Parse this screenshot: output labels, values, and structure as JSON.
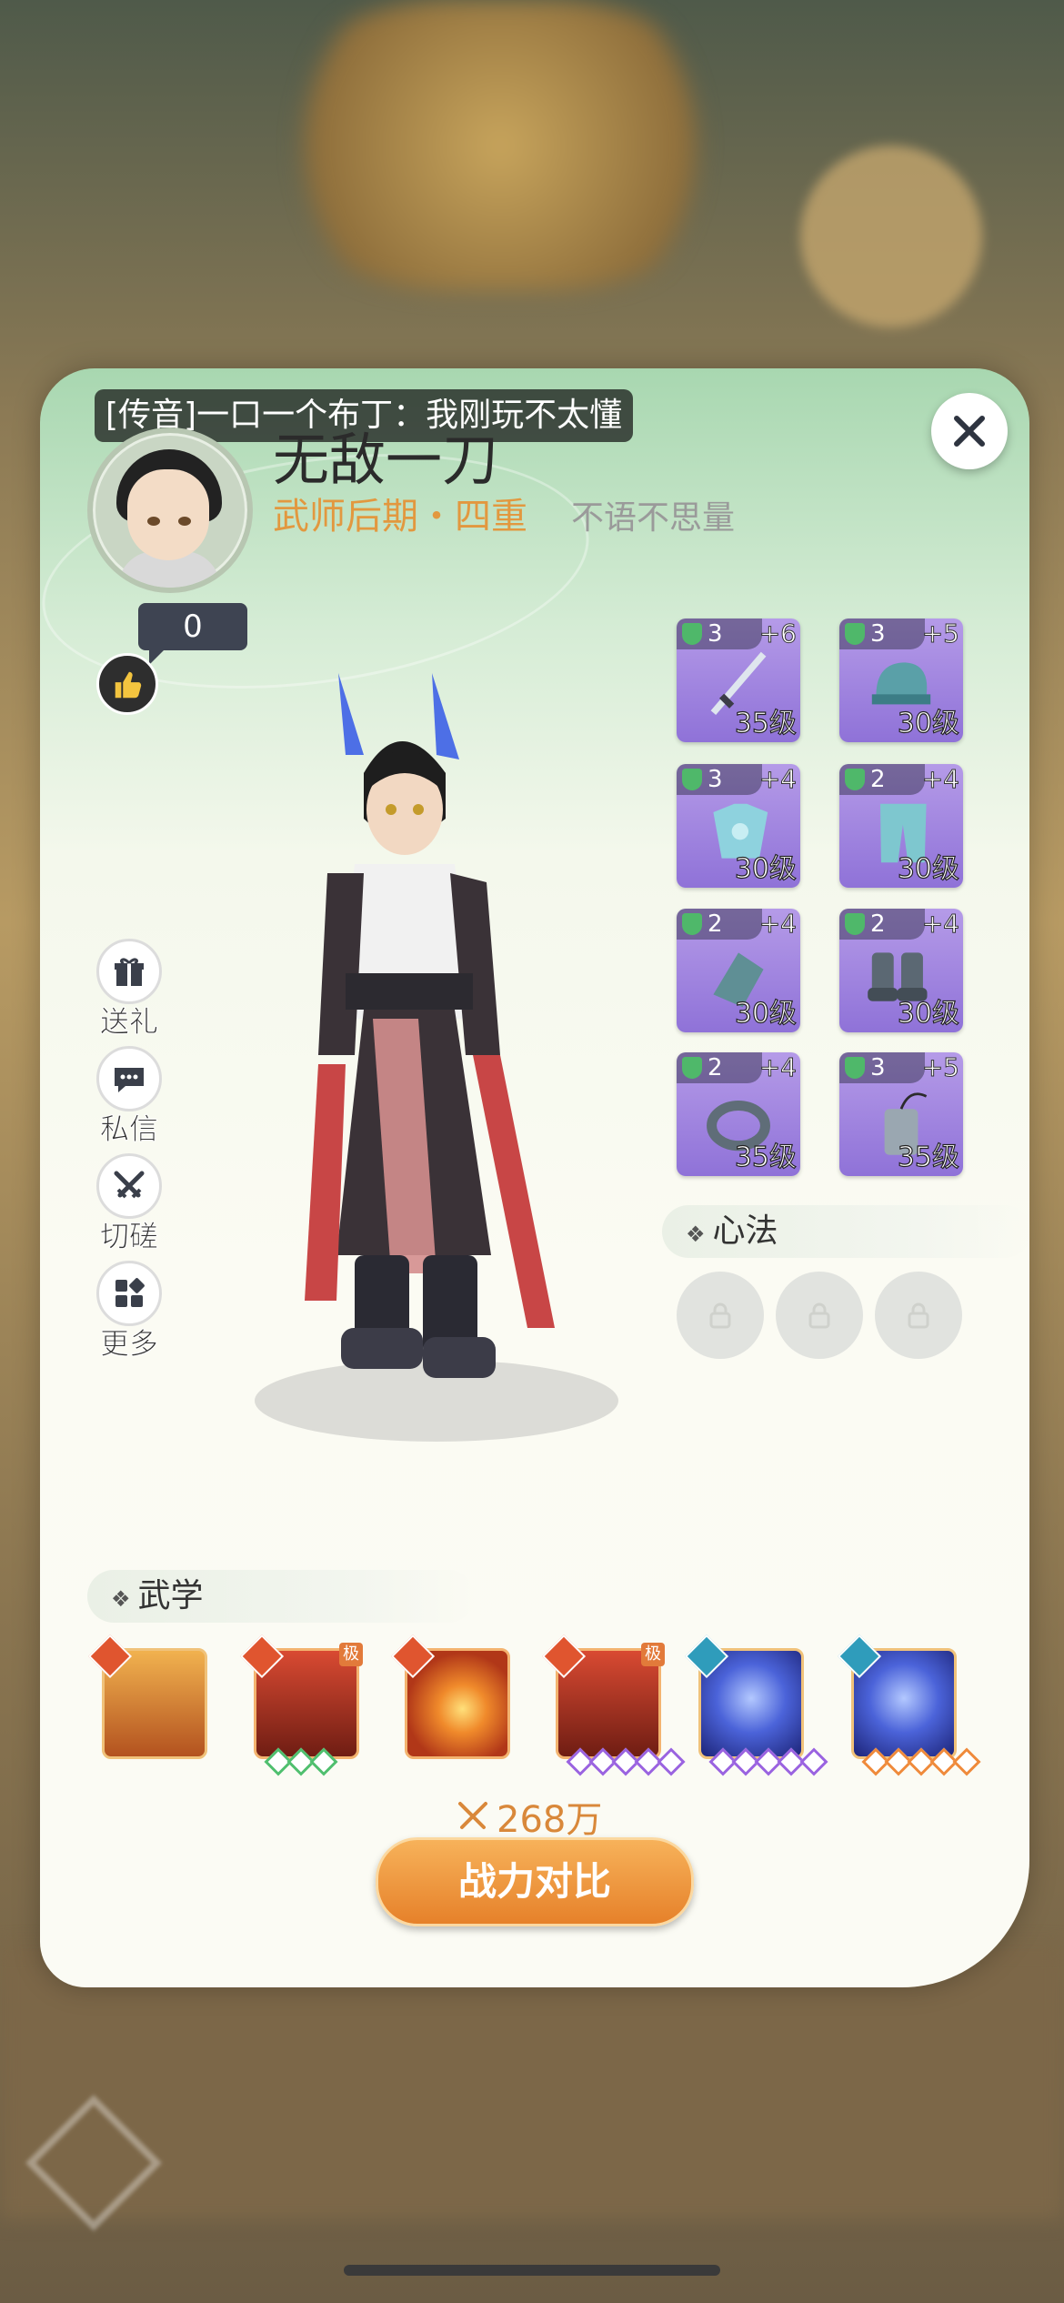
{
  "broadcast": "[传音]一口一个布丁：我刚玩不太懂",
  "player": {
    "name": "无敌一刀",
    "rank": "武师后期・四重",
    "motto": "不语不思量",
    "likes": "0"
  },
  "side_actions": [
    {
      "label": "送礼",
      "icon": "gift-icon"
    },
    {
      "label": "私信",
      "icon": "message-icon"
    },
    {
      "label": "切磋",
      "icon": "crossed-swords-icon"
    },
    {
      "label": "更多",
      "icon": "more-grid-icon"
    }
  ],
  "equipment": [
    {
      "slot": "weapon",
      "icon": "sword-icon",
      "gem": "3",
      "enhance": "+6",
      "level": "35级"
    },
    {
      "slot": "helmet",
      "icon": "helmet-icon",
      "gem": "3",
      "enhance": "+5",
      "level": "30级"
    },
    {
      "slot": "armor",
      "icon": "robe-icon",
      "gem": "3",
      "enhance": "+4",
      "level": "30级"
    },
    {
      "slot": "pants",
      "icon": "pants-icon",
      "gem": "2",
      "enhance": "+4",
      "level": "30级"
    },
    {
      "slot": "bracer",
      "icon": "bracer-icon",
      "gem": "2",
      "enhance": "+4",
      "level": "30级"
    },
    {
      "slot": "boots",
      "icon": "boots-icon",
      "gem": "2",
      "enhance": "+4",
      "level": "30级"
    },
    {
      "slot": "ring",
      "icon": "ring-icon",
      "gem": "2",
      "enhance": "+4",
      "level": "35级"
    },
    {
      "slot": "pendant",
      "icon": "pendant-icon",
      "gem": "3",
      "enhance": "+5",
      "level": "35级"
    }
  ],
  "heart_method": {
    "title": "心法",
    "slots_locked": 3
  },
  "martial": {
    "title": "武学",
    "skills": [
      {
        "icon": "palm-flame-icon",
        "pips": 0
      },
      {
        "icon": "flame-staff-icon",
        "pips": 3,
        "pip_color": "green",
        "tag": "极"
      },
      {
        "icon": "fireball-icon",
        "pips": 0
      },
      {
        "icon": "fist-strike-icon",
        "pips": 5,
        "pip_color": "purple",
        "tag": "极"
      },
      {
        "icon": "arcane-circle-icon",
        "pips": 5,
        "pip_color": "purple"
      },
      {
        "icon": "lightning-palm-icon",
        "pips": 5,
        "pip_color": "orange"
      }
    ]
  },
  "power": "268万",
  "compare_button": "战力对比",
  "colors": {
    "accent": "#e6812a",
    "rank": "#e2983f",
    "equip_purple": "#8f72d8"
  }
}
